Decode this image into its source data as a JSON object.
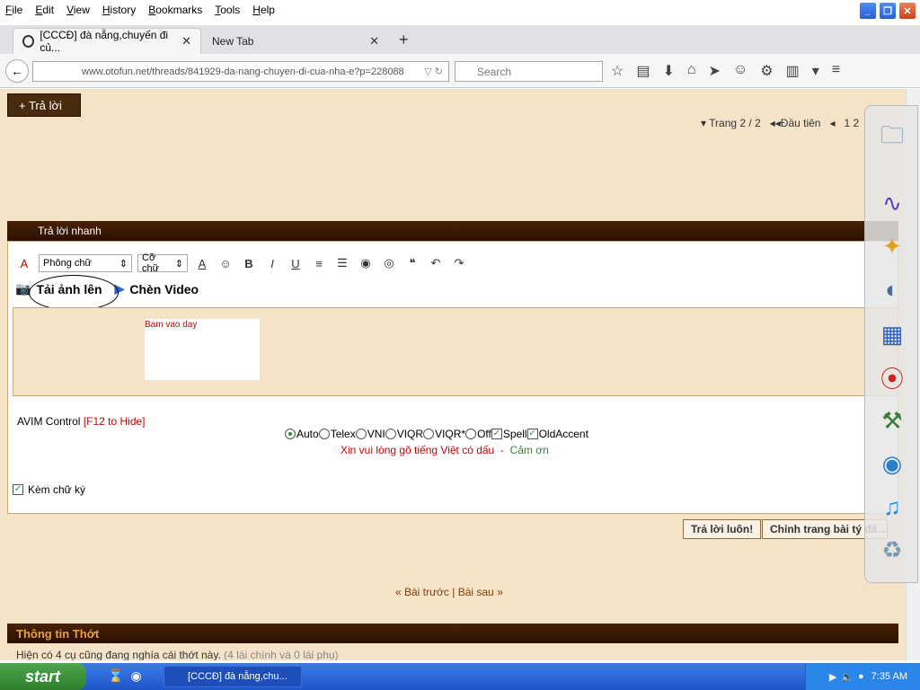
{
  "menubar": {
    "items": [
      "File",
      "Edit",
      "View",
      "History",
      "Bookmarks",
      "Tools",
      "Help"
    ]
  },
  "tabs": [
    {
      "label": "[CCCĐ] đà nẵng,chuyến đi củ..."
    },
    {
      "label": "New Tab"
    }
  ],
  "navbar": {
    "url": "www.otofun.net/threads/841929-da-nang-chuyen-di-cua-nha-e?p=228088",
    "search_placeholder": "Search"
  },
  "page": {
    "reply_button": "+ Trả lời",
    "pagination": {
      "page_label": "Trang 2 / 2",
      "first_label": "Đầu tiên",
      "pages": "1   2"
    },
    "quick_reply_title": "Trả lời nhanh",
    "toolbar": {
      "font_select": "Phông chữ",
      "size_select": "Cỡ chữ"
    },
    "upload_label": "Tải ảnh lên",
    "video_label": "Chèn Video",
    "annotation": "Bam vao day",
    "avim": {
      "label": "AVIM Control",
      "hide": "[F12 to Hide]"
    },
    "avim_options": {
      "auto": "Auto",
      "telex": "Telex",
      "vni": "VNI",
      "viqr": "VIQR",
      "viqr_star": "VIQR*",
      "off": "Off",
      "spell": "Spell",
      "old_accent": "OldAccent"
    },
    "viet_msg": "Xin vui lòng gõ tiếng Việt có dấu",
    "viet_sep": "-",
    "viet_thanks": "Cảm ơn",
    "signature_label": "Kèm chữ ký",
    "submit_button": "Trả lời luôn!",
    "advanced_button": "Chỉnh trang bài tý đã...",
    "prev_next": "« Bài trước | Bài sau »",
    "info_title": "Thông tin Thớt",
    "info_text": "Hiện có 4 cụ cũng đang nghía cái thớt này.",
    "info_sub": "(4 lái chính và 0 lái phụ)"
  },
  "taskbar": {
    "start_label": "start",
    "task_label": "[CCCĐ] đà nẵng,chu...",
    "clock": "7:35 AM"
  }
}
